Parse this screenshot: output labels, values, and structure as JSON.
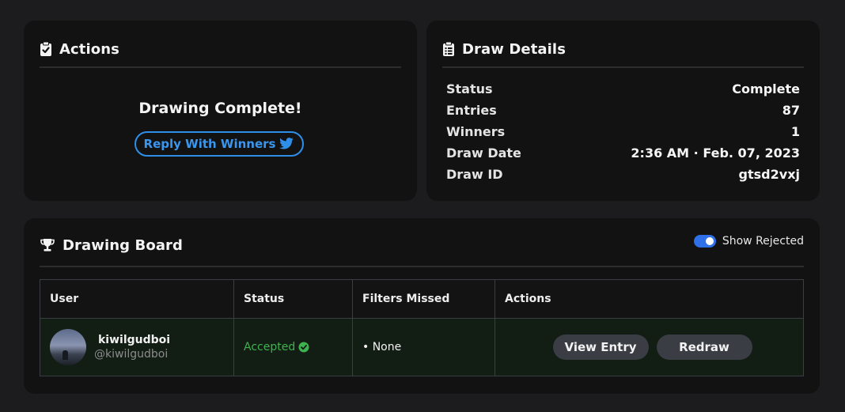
{
  "actions": {
    "title": "Actions",
    "icon": "clipboard-check-icon",
    "status_text": "Drawing Complete!",
    "reply_button": "Reply With Winners",
    "reply_icon": "twitter-icon"
  },
  "details": {
    "title": "Draw Details",
    "icon": "clipboard-list-icon",
    "rows": [
      {
        "label": "Status",
        "value": "Complete"
      },
      {
        "label": "Entries",
        "value": "87"
      },
      {
        "label": "Winners",
        "value": "1"
      },
      {
        "label": "Draw Date",
        "value": "2:36 AM · Feb. 07, 2023"
      },
      {
        "label": "Draw ID",
        "value": "gtsd2vxj"
      }
    ]
  },
  "board": {
    "title": "Drawing Board",
    "icon": "trophy-icon",
    "toggle_label": "Show Rejected",
    "toggle_on": true,
    "columns": [
      "User",
      "Status",
      "Filters Missed",
      "Actions"
    ],
    "rows": [
      {
        "username": "kiwilgudboi",
        "handle": "@kiwilgudboi",
        "status": "Accepted",
        "filters_missed": "• None",
        "view_button": "View Entry",
        "redraw_button": "Redraw"
      }
    ]
  },
  "colors": {
    "accent_blue": "#2f8fe8",
    "success_green": "#3fb24f",
    "card_bg": "#121212",
    "page_bg": "#1c1c1e"
  }
}
